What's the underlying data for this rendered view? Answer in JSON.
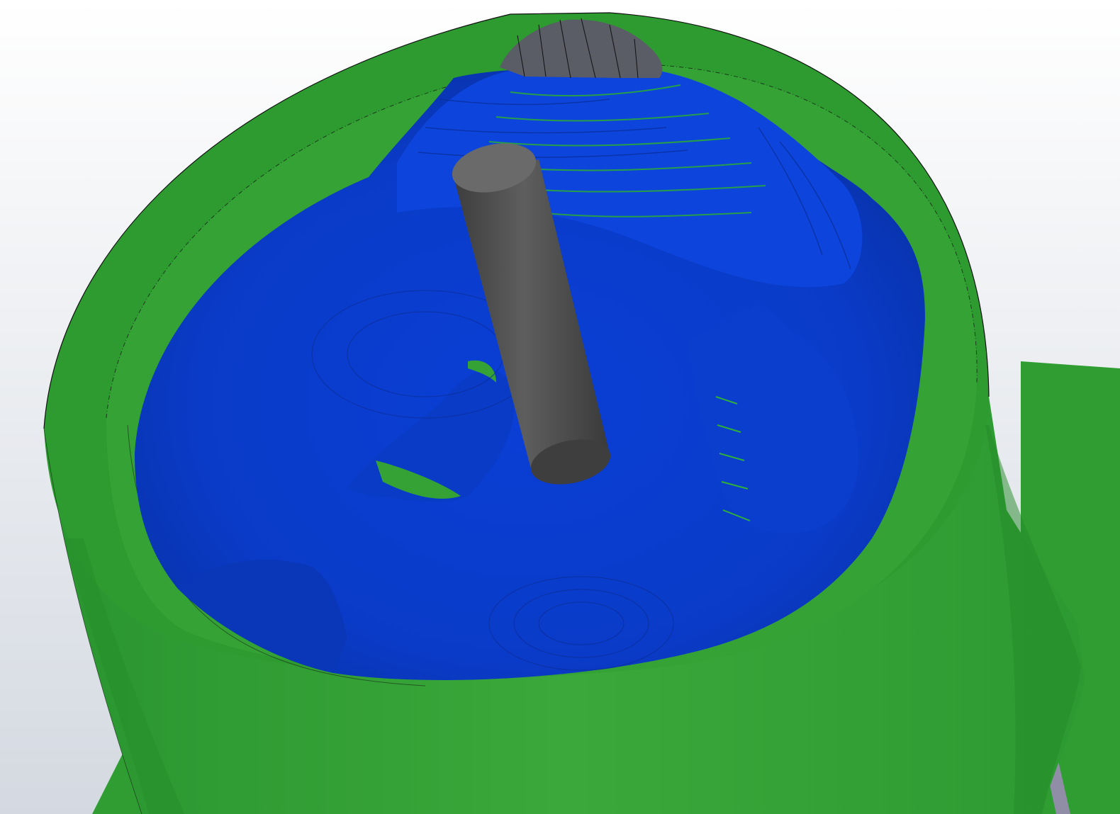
{
  "viewport": {
    "colors": {
      "background_light": "#ffffff",
      "background_dark": "#d4d9e1",
      "stock_green": "#2d9b2f",
      "stock_green_light": "#47b33f",
      "stock_green_dark": "#1f7a24",
      "cut_blue": "#0b3fd1",
      "cut_blue_dark": "#0630a8",
      "cut_blue_light": "#2a62f0",
      "tool_gray": "#555555",
      "tool_gray_dark": "#3a3a3a",
      "tool_gray_light": "#6a6a6a",
      "fixture_gray": "#8f8ea6",
      "edge_line": "#111111"
    },
    "scene_objects": [
      "base-plate",
      "cylindrical-stock",
      "machined-pocket",
      "end-mill-tool"
    ]
  }
}
